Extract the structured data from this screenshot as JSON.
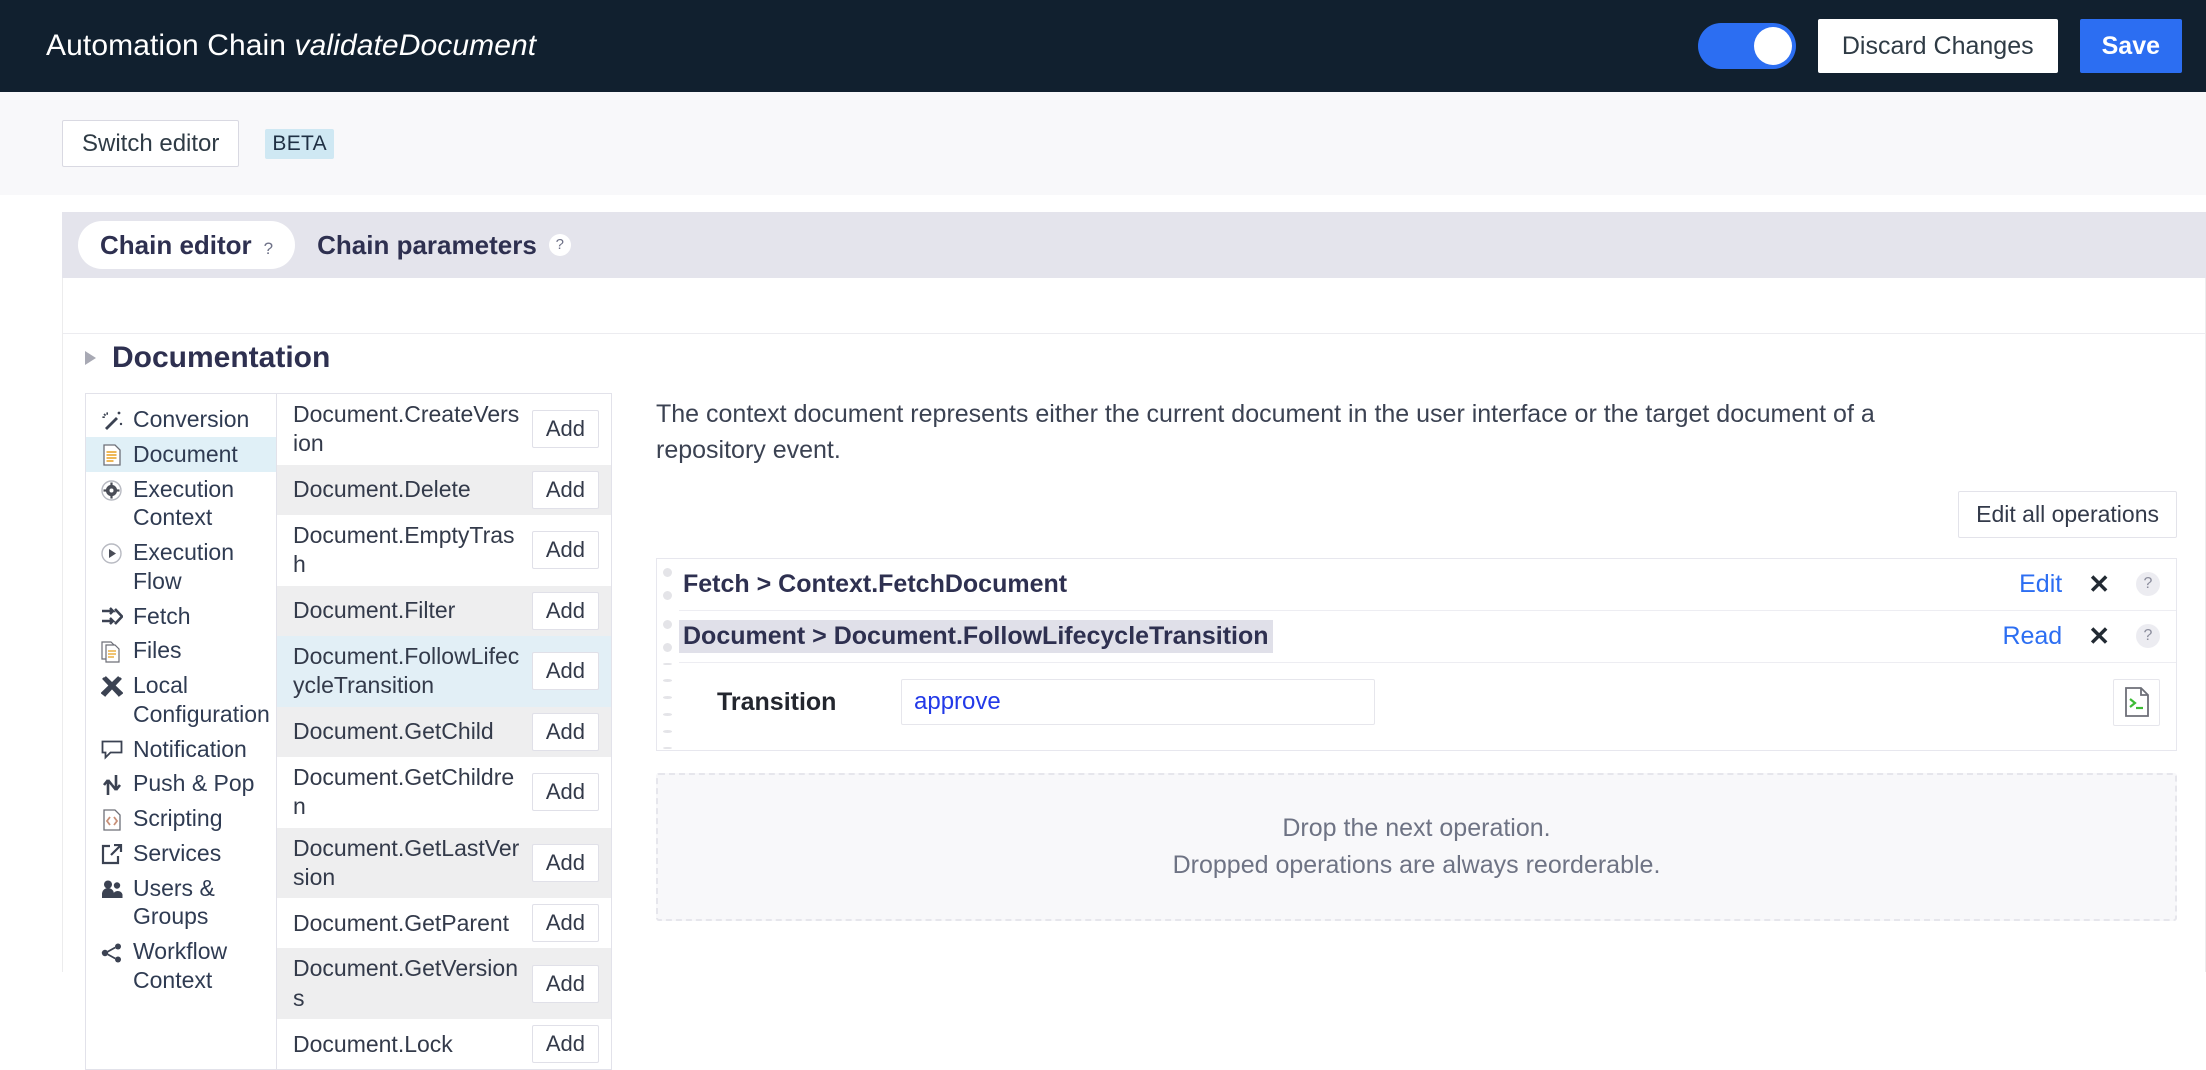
{
  "header": {
    "title_prefix": "Automation Chain",
    "chain_name": "validateDocument",
    "toggle_state": "on",
    "discard_label": "Discard Changes",
    "save_label": "Save",
    "accent_color": "#2c6ef2",
    "bar_color": "#11202f"
  },
  "subbar": {
    "switch_editor_label": "Switch editor",
    "beta_label": "BETA",
    "beta_bg": "#cfe8f3"
  },
  "tabs": [
    {
      "label": "Chain editor",
      "help": "?",
      "active": true
    },
    {
      "label": "Chain parameters",
      "help": "?",
      "active": false
    }
  ],
  "documentation": {
    "title": "Documentation",
    "expanded": false,
    "caret_icon": "triangle-right-icon"
  },
  "categories": [
    {
      "label": "Conversion",
      "icon": "magic-wand-icon",
      "selected": false
    },
    {
      "label": "Document",
      "icon": "document-icon",
      "selected": true
    },
    {
      "label": "Execution Context",
      "icon": "gear-circle-icon",
      "selected": false
    },
    {
      "label": "Execution Flow",
      "icon": "play-circle-icon",
      "selected": false
    },
    {
      "label": "Fetch",
      "icon": "arrows-right-icon",
      "selected": false
    },
    {
      "label": "Files",
      "icon": "documents-stack-icon",
      "selected": false
    },
    {
      "label": "Local Configuration",
      "icon": "tools-icon",
      "selected": false
    },
    {
      "label": "Notification",
      "icon": "speech-bubble-icon",
      "selected": false
    },
    {
      "label": "Push & Pop",
      "icon": "up-down-arrows-icon",
      "selected": false
    },
    {
      "label": "Scripting",
      "icon": "code-file-icon",
      "selected": false
    },
    {
      "label": "Services",
      "icon": "share-export-icon",
      "selected": false
    },
    {
      "label": "Users & Groups",
      "icon": "users-icon",
      "selected": false
    },
    {
      "label": "Workflow Context",
      "icon": "network-share-icon",
      "selected": false
    }
  ],
  "operations": {
    "add_label": "Add",
    "items": [
      {
        "name": "Document.CreateVersion",
        "style": "plain"
      },
      {
        "name": "Document.Delete",
        "style": "alt"
      },
      {
        "name": "Document.EmptyTrash",
        "style": "plain"
      },
      {
        "name": "Document.Filter",
        "style": "alt"
      },
      {
        "name": "Document.FollowLifecycleTransition",
        "style": "highlight"
      },
      {
        "name": "Document.GetChild",
        "style": "alt"
      },
      {
        "name": "Document.GetChildren",
        "style": "plain"
      },
      {
        "name": "Document.GetLastVersion",
        "style": "alt"
      },
      {
        "name": "Document.GetParent",
        "style": "plain"
      },
      {
        "name": "Document.GetVersions",
        "style": "alt"
      },
      {
        "name": "Document.Lock",
        "style": "plain"
      }
    ]
  },
  "context": {
    "description": "The context document represents either the current document in the user interface or the target document of a repository event.",
    "edit_all_label": "Edit all operations"
  },
  "chain": {
    "rows": [
      {
        "label": "Fetch > Context.FetchDocument",
        "action_label": "Edit",
        "close_icon": "✕",
        "help_icon": "?",
        "selected": false
      },
      {
        "label": "Document > Document.FollowLifecycleTransition",
        "action_label": "Read",
        "close_icon": "✕",
        "help_icon": "?",
        "selected": true
      }
    ],
    "parameter": {
      "label": "Transition",
      "value": "approve",
      "placeholder": "",
      "script_icon": "script-file-icon"
    }
  },
  "dropzone": {
    "line1": "Drop the next operation.",
    "line2": "Dropped operations are always reorderable."
  }
}
